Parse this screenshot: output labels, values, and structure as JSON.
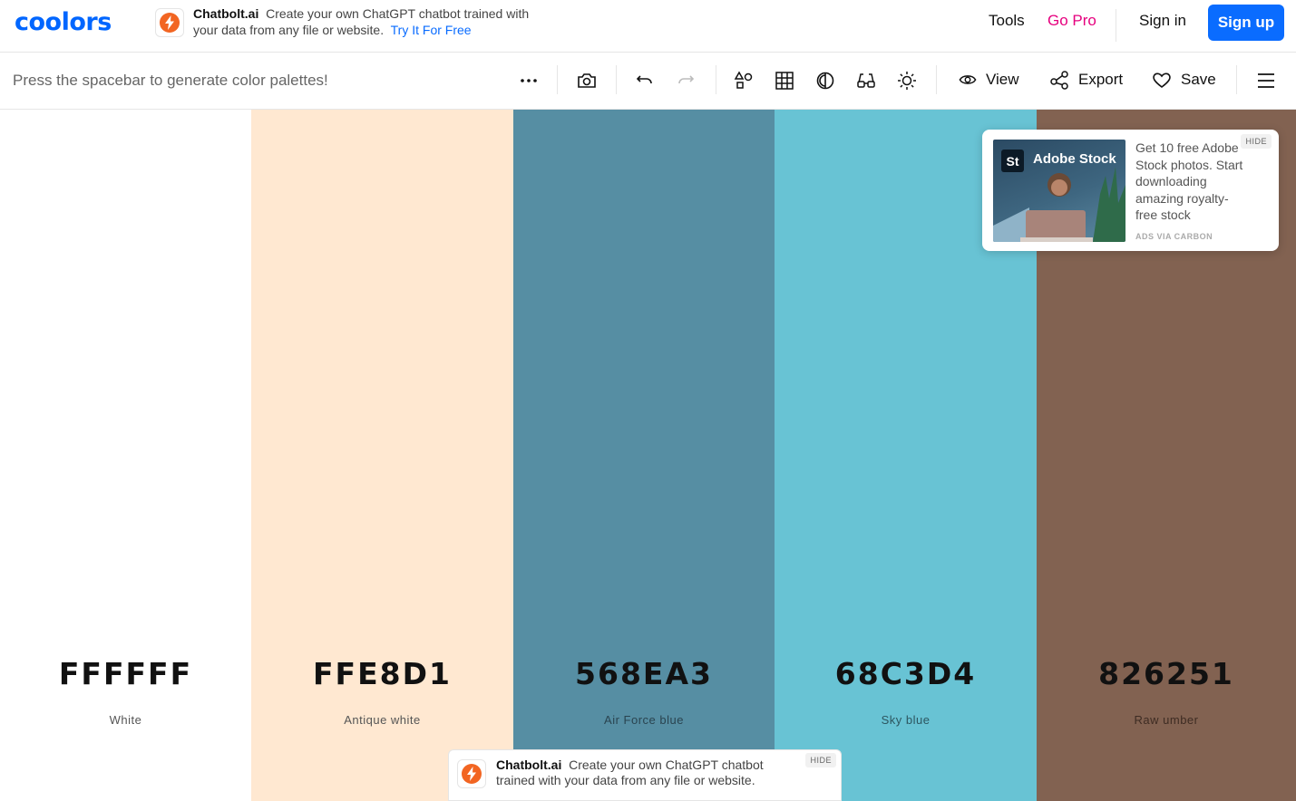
{
  "header": {
    "logo": "coolors",
    "promo": {
      "brand": "Chatbolt.ai",
      "text": "Create your own ChatGPT chatbot trained with your data from any file or website.",
      "cta": "Try It For Free"
    },
    "nav": {
      "tools": "Tools",
      "go_pro": "Go Pro",
      "sign_in": "Sign in",
      "sign_up": "Sign up"
    }
  },
  "toolbar": {
    "hint": "Press the spacebar to generate color palettes!",
    "view_label": "View",
    "export_label": "Export",
    "save_label": "Save"
  },
  "palette": [
    {
      "hex": "FFFFFF",
      "name": "White",
      "color": "#FFFFFF",
      "hex_text": "#111111",
      "name_text": "#555555"
    },
    {
      "hex": "FFE8D1",
      "name": "Antique white",
      "color": "#FFE8D1",
      "hex_text": "#111111",
      "name_text": "#555555"
    },
    {
      "hex": "568EA3",
      "name": "Air Force blue",
      "color": "#568EA3",
      "hex_text": "#111111",
      "name_text": "#2a4450"
    },
    {
      "hex": "68C3D4",
      "name": "Sky blue",
      "color": "#68C3D4",
      "hex_text": "#111111",
      "name_text": "#2d5660"
    },
    {
      "hex": "826251",
      "name": "Raw umber",
      "color": "#826251",
      "hex_text": "#111111",
      "name_text": "#3e2c23"
    }
  ],
  "side_ad": {
    "image_brand": "Adobe Stock",
    "image_badge": "St",
    "text": "Get 10 free Adobe Stock photos. Start downloading amazing royalty-free stock",
    "via": "ADS VIA CARBON",
    "hide": "HIDE"
  },
  "bottom_ad": {
    "brand": "Chatbolt.ai",
    "text": "Create your own ChatGPT chatbot trained with your data from any file or website.",
    "hide": "HIDE"
  },
  "colors": {
    "accent": "#0A6CFF",
    "pro": "#E6007E"
  }
}
